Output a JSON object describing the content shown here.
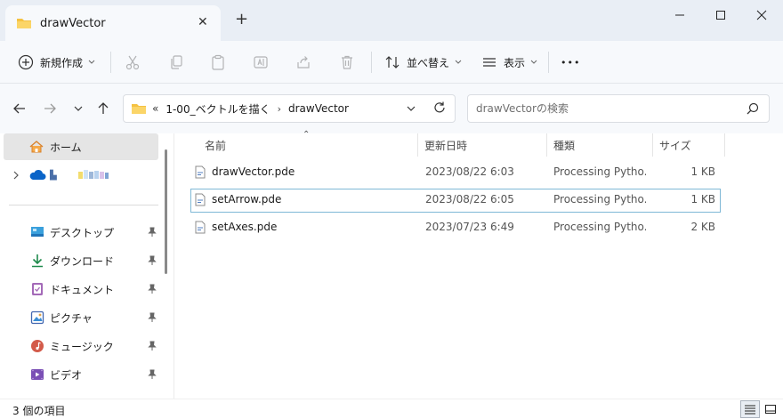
{
  "window": {
    "tab_title": "drawVector",
    "tab_close": "✕",
    "new_tab": "+"
  },
  "toolbar": {
    "new_label": "新規作成",
    "sort_label": "並べ替え",
    "view_label": "表示",
    "more": "•••"
  },
  "address": {
    "overflow": "«",
    "crumbs": [
      "1-00_ベクトルを描く",
      "drawVector"
    ],
    "separator": "›"
  },
  "search": {
    "placeholder": "drawVectorの検索"
  },
  "sidebar": {
    "home_label": "ホーム",
    "onedrive_label": "▙",
    "quick_access": [
      {
        "label": "デスクトップ"
      },
      {
        "label": "ダウンロード"
      },
      {
        "label": "ドキュメント"
      },
      {
        "label": "ピクチャ"
      },
      {
        "label": "ミュージック"
      },
      {
        "label": "ビデオ"
      }
    ]
  },
  "columns": {
    "name": "名前",
    "modified": "更新日時",
    "type": "種類",
    "size": "サイズ",
    "sort_indicator": "⌃"
  },
  "files": [
    {
      "name": "drawVector.pde",
      "modified": "2023/08/22 6:03",
      "type": "Processing Pytho...",
      "size": "1 KB"
    },
    {
      "name": "setArrow.pde",
      "modified": "2023/08/22 6:05",
      "type": "Processing Pytho...",
      "size": "1 KB"
    },
    {
      "name": "setAxes.pde",
      "modified": "2023/07/23 6:49",
      "type": "Processing Pytho...",
      "size": "2 KB"
    }
  ],
  "status": {
    "item_count": "3 個の項目"
  },
  "colors": {
    "folder": "#f5c242",
    "accent": "#0067c0",
    "titlebar": "#e9eef5",
    "toolbar": "#f7f9fc"
  }
}
